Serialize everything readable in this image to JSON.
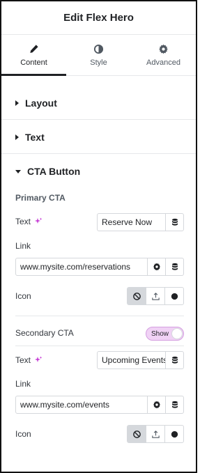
{
  "header": {
    "title": "Edit Flex Hero"
  },
  "tabs": [
    {
      "label": "Content",
      "icon": "pencil-icon",
      "active": true
    },
    {
      "label": "Style",
      "icon": "half-circle-icon",
      "active": false
    },
    {
      "label": "Advanced",
      "icon": "gear-icon",
      "active": false
    }
  ],
  "sections": {
    "layout": {
      "label": "Layout",
      "expanded": false
    },
    "text": {
      "label": "Text",
      "expanded": false
    },
    "cta": {
      "label": "CTA Button",
      "expanded": true
    }
  },
  "primary": {
    "heading": "Primary CTA",
    "text_label": "Text",
    "text_value": "Reserve Now",
    "link_label": "Link",
    "link_value": "www.mysite.com/reservations",
    "icon_label": "Icon",
    "icon_selected": "none"
  },
  "secondary": {
    "heading": "Secondary CTA",
    "toggle_label": "Show",
    "text_label": "Text",
    "text_value": "Upcoming Events",
    "link_label": "Link",
    "link_value": "www.mysite.com/events",
    "icon_label": "Icon",
    "icon_selected": "none"
  },
  "colors": {
    "accent_pink": "#c740d6",
    "toggle_bg": "#f0d2f5",
    "border": "#d5d8dc"
  }
}
